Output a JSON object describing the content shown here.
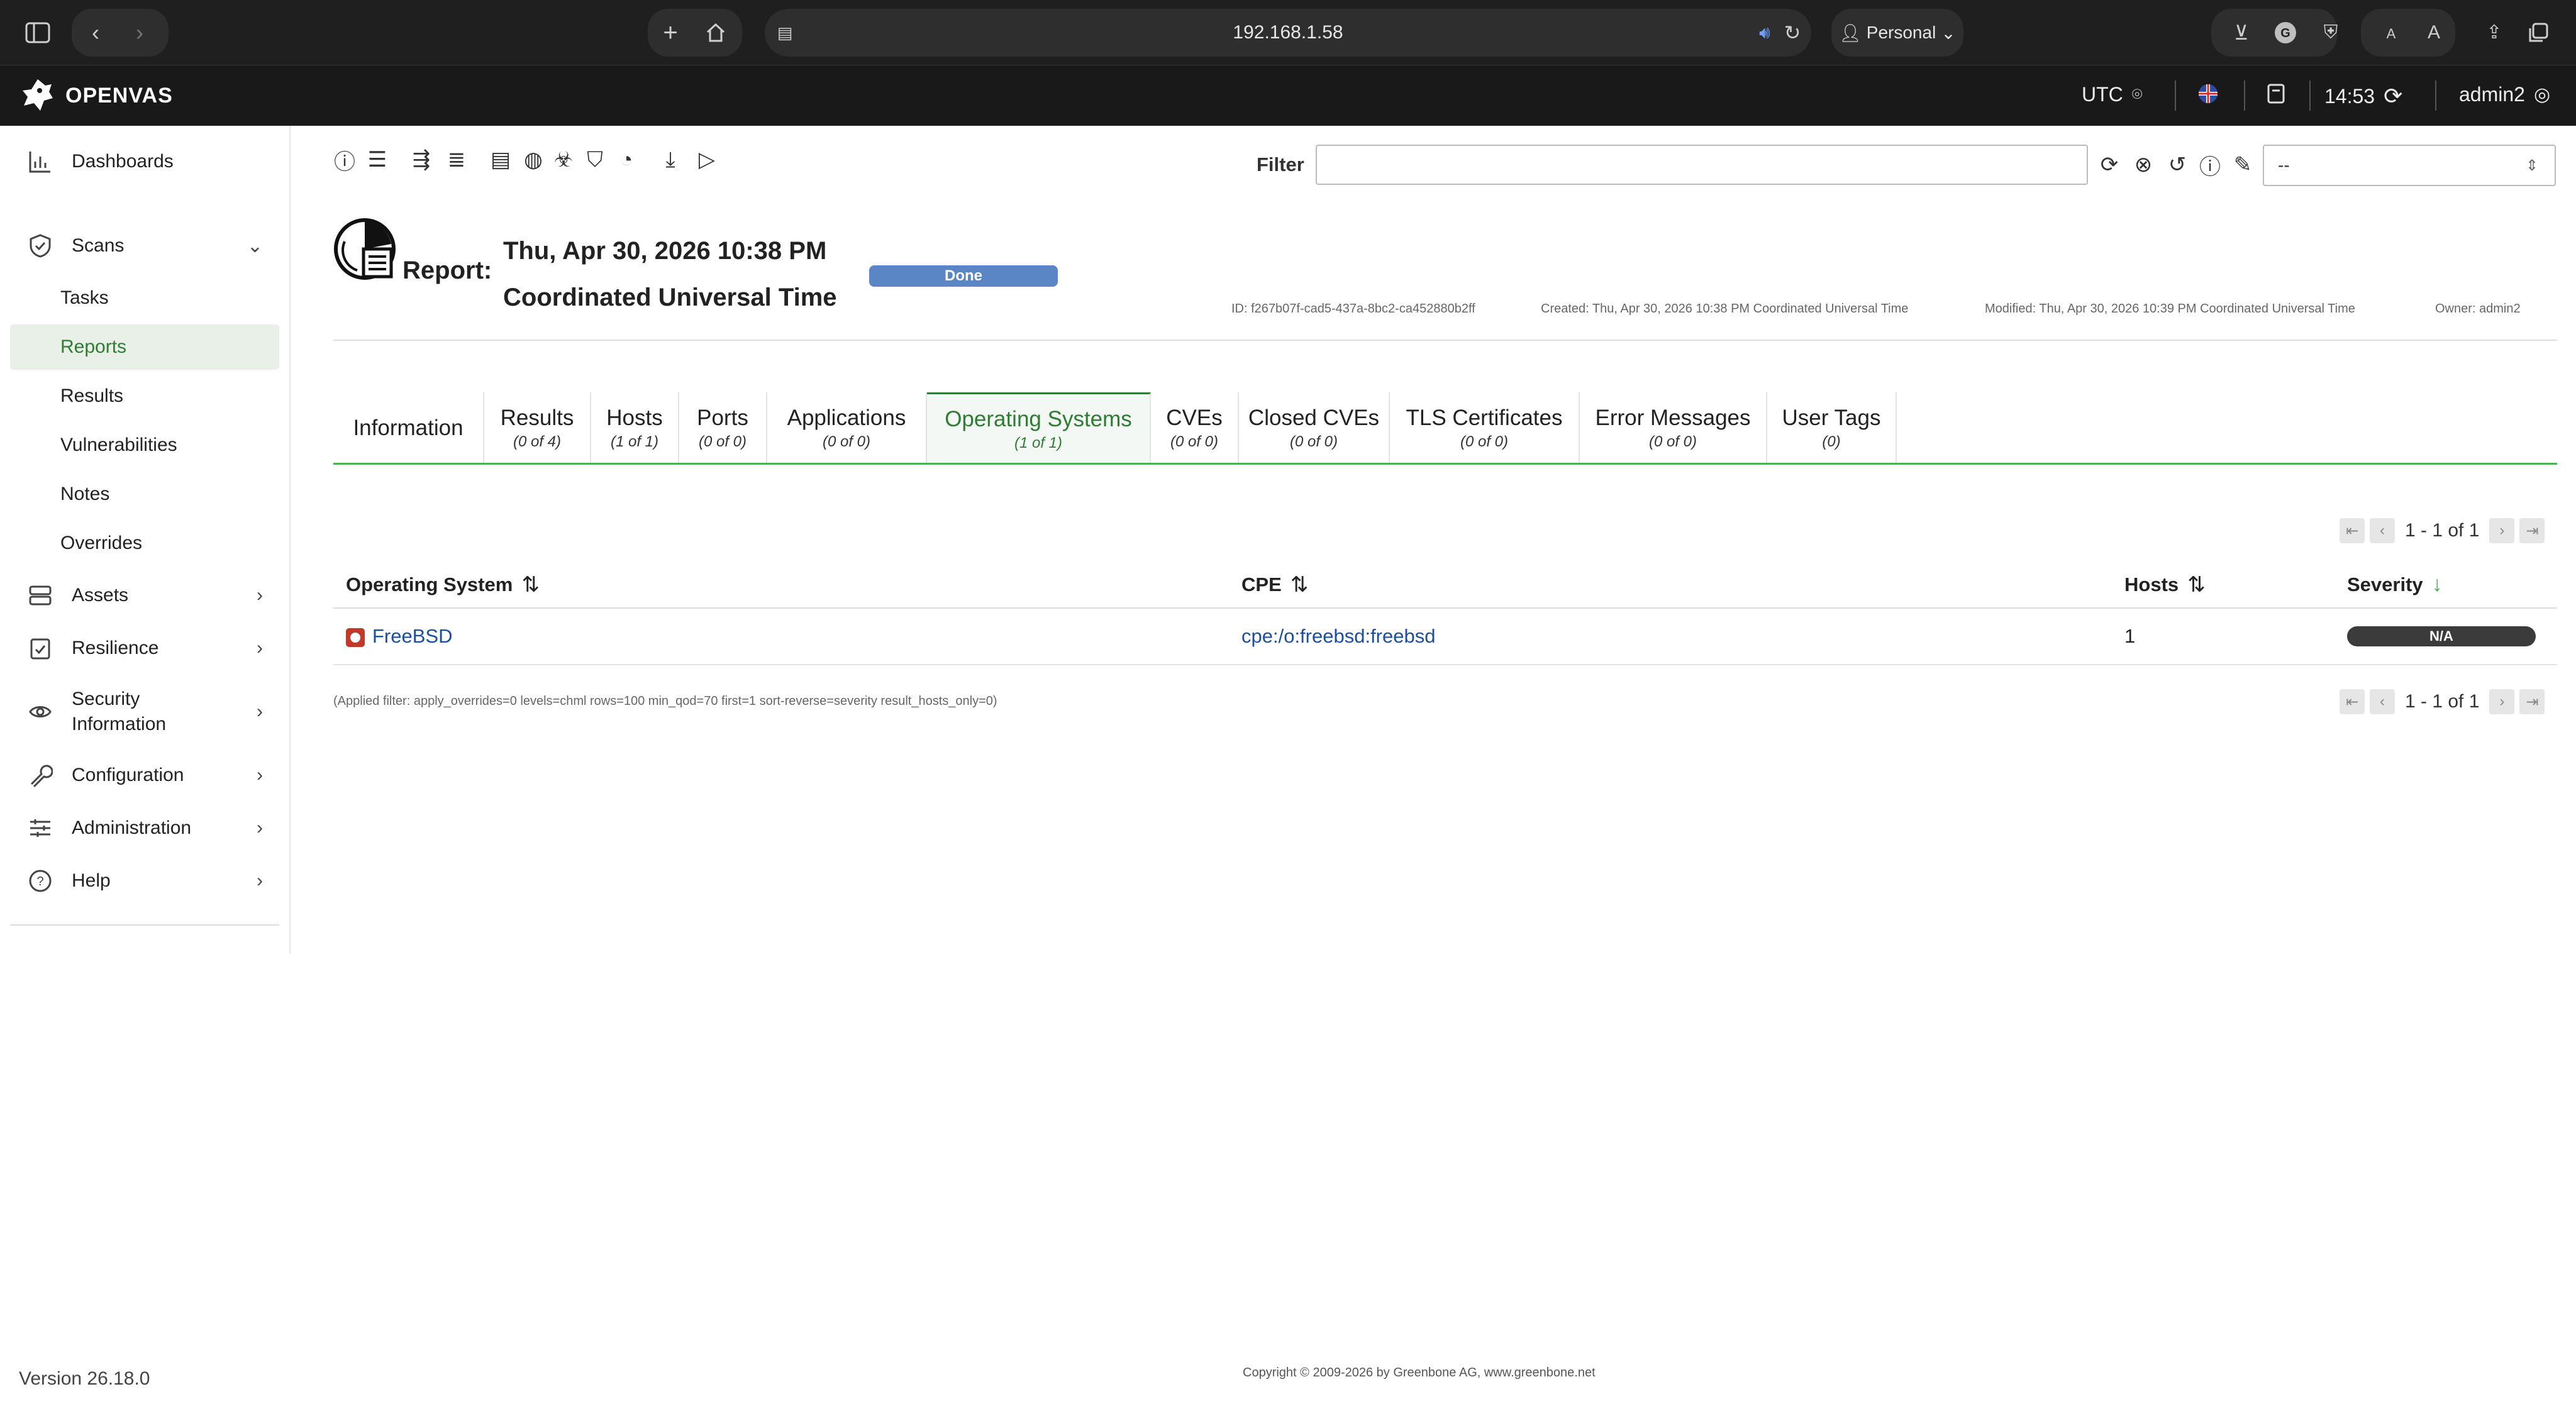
{
  "browser": {
    "url": "192.168.1.58",
    "profile": "Personal",
    "reader_small": "A",
    "reader_large": "A"
  },
  "header": {
    "app_name": "OPENVAS",
    "timezone": "UTC",
    "time": "14:53",
    "user": "admin2"
  },
  "sidebar": {
    "dashboards": "Dashboards",
    "scans": "Scans",
    "scans_sub": [
      "Tasks",
      "Reports",
      "Results",
      "Vulnerabilities",
      "Notes",
      "Overrides"
    ],
    "assets": "Assets",
    "resilience": "Resilience",
    "security_information_1": "Security",
    "security_information_2": "Information",
    "configuration": "Configuration",
    "administration": "Administration",
    "help": "Help",
    "version": "Version 26.18.0"
  },
  "filter": {
    "label": "Filter",
    "value": "",
    "select_value": "--"
  },
  "report": {
    "label": "Report:",
    "date": "Thu, Apr 30, 2026 10:38 PM",
    "tz": "Coordinated Universal Time",
    "status": "Done",
    "id": "ID: f267b07f-cad5-437a-8bc2-ca452880b2ff",
    "created": "Created: Thu, Apr 30, 2026 10:38 PM Coordinated Universal Time",
    "modified": "Modified: Thu, Apr 30, 2026 10:39 PM Coordinated Universal Time",
    "owner": "Owner: admin2"
  },
  "tabs": [
    {
      "label": "Information",
      "count": ""
    },
    {
      "label": "Results",
      "count": "(0 of 4)"
    },
    {
      "label": "Hosts",
      "count": "(1 of 1)"
    },
    {
      "label": "Ports",
      "count": "(0 of 0)"
    },
    {
      "label": "Applications",
      "count": "(0 of 0)"
    },
    {
      "label": "Operating Systems",
      "count": "(1 of 1)"
    },
    {
      "label": "CVEs",
      "count": "(0 of 0)"
    },
    {
      "label": "Closed CVEs",
      "count": "(0 of 0)"
    },
    {
      "label": "TLS Certificates",
      "count": "(0 of 0)"
    },
    {
      "label": "Error Messages",
      "count": "(0 of 0)"
    },
    {
      "label": "User Tags",
      "count": "(0)"
    }
  ],
  "pagination": {
    "text": "1 - 1 of 1"
  },
  "table": {
    "columns": [
      "Operating System",
      "CPE",
      "Hosts",
      "Severity"
    ],
    "rows": [
      {
        "os": "FreeBSD",
        "cpe": "cpe:/o:freebsd:freebsd",
        "hosts": "1",
        "severity": "N/A"
      }
    ]
  },
  "applied_filter": "(Applied filter: apply_overrides=0 levels=chml rows=100 min_qod=70 first=1 sort-reverse=severity result_hosts_only=0)",
  "footer": {
    "copyright": "Copyright © 2009-2026 by Greenbone AG, www.greenbone.net"
  }
}
